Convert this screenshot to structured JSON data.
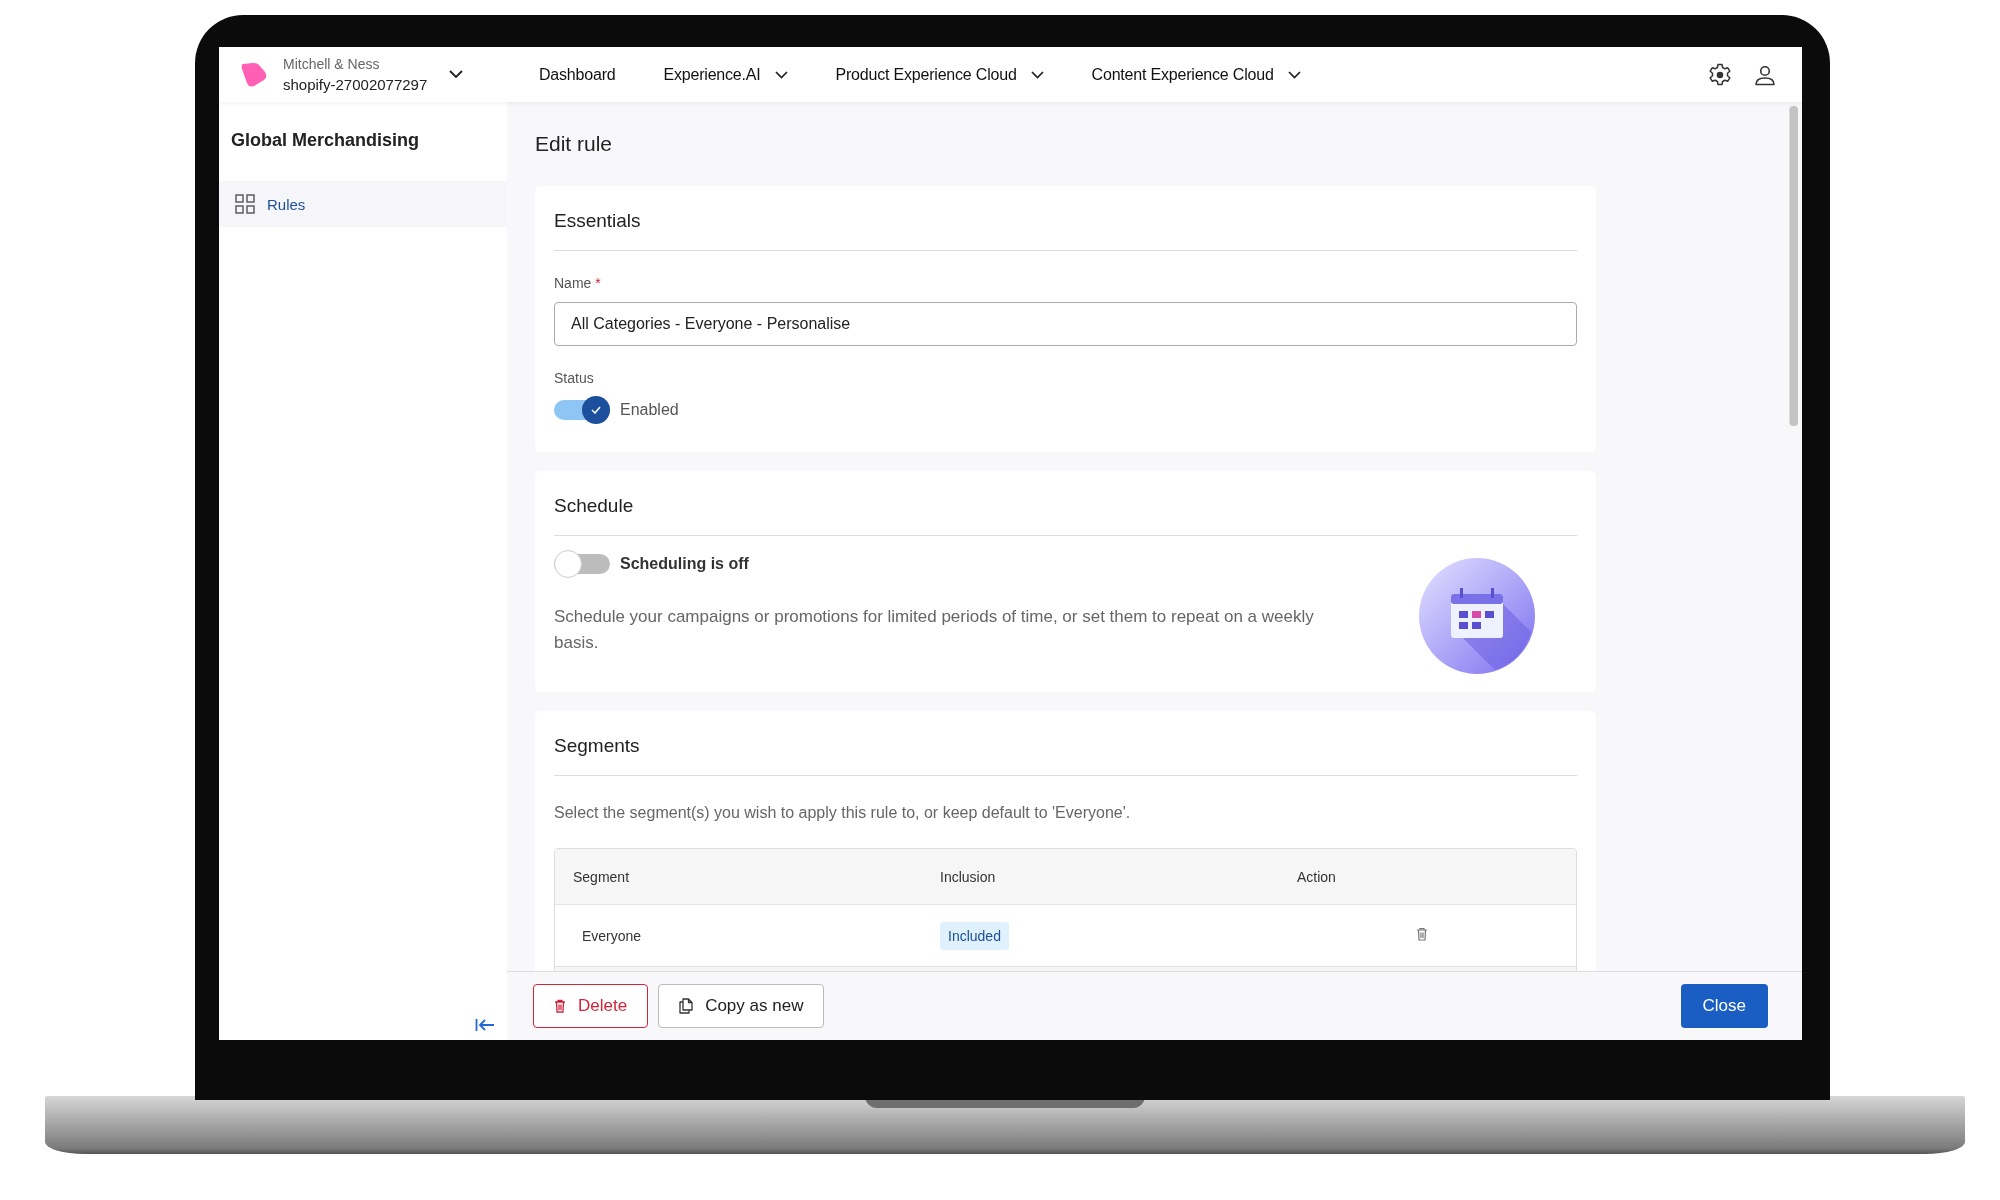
{
  "brand": {
    "company": "Mitchell & Ness",
    "store": "shopify-27002077297"
  },
  "nav": [
    {
      "label": "Dashboard",
      "dropdown": false
    },
    {
      "label": "Experience.AI",
      "dropdown": true
    },
    {
      "label": "Product Experience Cloud",
      "dropdown": true
    },
    {
      "label": "Content Experience Cloud",
      "dropdown": true
    }
  ],
  "sidebar": {
    "title": "Global Merchandising",
    "items": [
      {
        "label": "Rules",
        "selected": true
      }
    ]
  },
  "page_title": "Edit rule",
  "essentials": {
    "title": "Essentials",
    "name_label": "Name",
    "required_mark": "*",
    "name_value": "All Categories - Everyone - Personalise",
    "status_label": "Status",
    "status": {
      "on": true,
      "label": "Enabled"
    }
  },
  "schedule": {
    "title": "Schedule",
    "toggle": {
      "on": false,
      "label": "Scheduling is off"
    },
    "description": "Schedule your campaigns or promotions for limited periods of time, or set them to repeat on a weekly basis."
  },
  "segments": {
    "title": "Segments",
    "description": "Select the segment(s) you wish to apply this rule to, or keep default to 'Everyone'.",
    "columns": [
      "Segment",
      "Inclusion",
      "Action"
    ],
    "rows": [
      {
        "segment": "Everyone",
        "inclusion": "Included"
      }
    ]
  },
  "footer": {
    "buttons": [
      {
        "label": "Delete",
        "kind": "danger"
      },
      {
        "label": "Copy as new",
        "kind": "copy"
      },
      {
        "label": "Close",
        "kind": "primary"
      }
    ]
  }
}
